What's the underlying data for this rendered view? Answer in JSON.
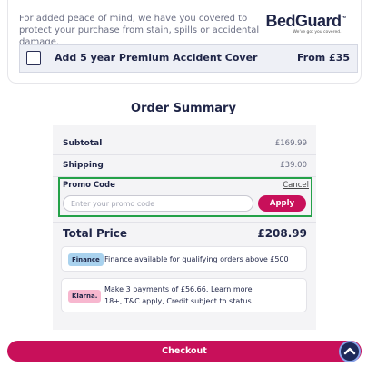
{
  "cover": {
    "text": "For added peace of mind, we have you covered to protect your purchase from stain, spills or accidental damage.",
    "logo": "BedGuard",
    "logo_tm": "™",
    "logo_tagline": "We've got you covered.",
    "addon_label": "Add 5 year Premium Accident Cover",
    "addon_price": "From £35",
    "addon_checked": false
  },
  "summary": {
    "title": "Order Summary",
    "subtotal_label": "Subtotal",
    "subtotal_value": "£169.99",
    "shipping_label": "Shipping",
    "shipping_value": "£39.00",
    "promo_label": "Promo Code",
    "promo_cancel": "Cancel",
    "promo_placeholder": "Enter your promo code",
    "promo_value": "",
    "apply_label": "Apply",
    "total_label": "Total Price",
    "total_value": "£208.99"
  },
  "finance": {
    "badge": "Finance",
    "text": "Finance available for qualifying orders above £500"
  },
  "klarna": {
    "badge": "Klarna.",
    "text_main": "Make 3 payments of £56.66.",
    "learn_more": "Learn more",
    "text_sub": "18+, T&C apply, Credit subject to status."
  },
  "checkout": {
    "label": "Checkout"
  },
  "colors": {
    "accent": "#c8105a",
    "navy": "#1f2547",
    "highlight": "#24a148"
  }
}
